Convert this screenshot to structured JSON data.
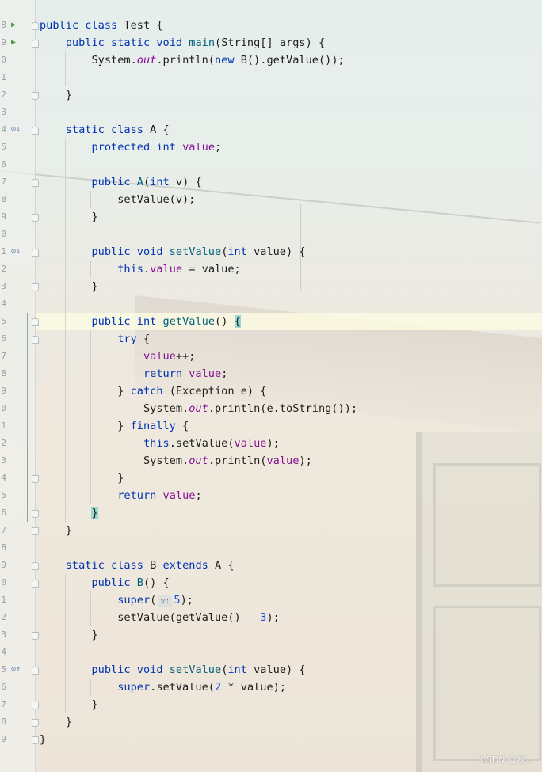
{
  "editor": {
    "lines": [
      {
        "n": "8",
        "marker": "run",
        "fold": "start",
        "tokens": [
          {
            "t": "public ",
            "c": "kw"
          },
          {
            "t": "class ",
            "c": "kw"
          },
          {
            "t": "Test {",
            "c": ""
          }
        ]
      },
      {
        "n": "9",
        "marker": "run",
        "fold": "start",
        "tokens": [
          {
            "t": "    "
          },
          {
            "t": "public ",
            "c": "kw"
          },
          {
            "t": "static ",
            "c": "kw"
          },
          {
            "t": "void ",
            "c": "kw"
          },
          {
            "t": "main",
            "c": "fn"
          },
          {
            "t": "(String[] args) {"
          }
        ]
      },
      {
        "n": "0",
        "fold": "",
        "tokens": [
          {
            "t": "        System."
          },
          {
            "t": "out",
            "c": "st"
          },
          {
            "t": ".println("
          },
          {
            "t": "new ",
            "c": "kw"
          },
          {
            "t": "B().getValue());"
          }
        ]
      },
      {
        "n": "1",
        "fold": "",
        "tokens": []
      },
      {
        "n": "2",
        "fold": "end",
        "tokens": [
          {
            "t": "    }"
          }
        ]
      },
      {
        "n": "3",
        "fold": "",
        "tokens": []
      },
      {
        "n": "4",
        "marker": "override",
        "fold": "start",
        "tokens": [
          {
            "t": "    "
          },
          {
            "t": "static ",
            "c": "kw"
          },
          {
            "t": "class ",
            "c": "kw"
          },
          {
            "t": "A {"
          }
        ]
      },
      {
        "n": "5",
        "fold": "",
        "tokens": [
          {
            "t": "        "
          },
          {
            "t": "protected ",
            "c": "kw"
          },
          {
            "t": "int ",
            "c": "kw"
          },
          {
            "t": "value",
            "c": "fld"
          },
          {
            "t": ";"
          }
        ]
      },
      {
        "n": "6",
        "fold": "",
        "tokens": []
      },
      {
        "n": "7",
        "fold": "start",
        "tokens": [
          {
            "t": "        "
          },
          {
            "t": "public ",
            "c": "kw"
          },
          {
            "t": "A",
            "c": "fn"
          },
          {
            "t": "("
          },
          {
            "t": "int ",
            "c": "kw"
          },
          {
            "t": "v) {"
          }
        ]
      },
      {
        "n": "8",
        "fold": "",
        "tokens": [
          {
            "t": "            setValue(v);"
          }
        ]
      },
      {
        "n": "9",
        "fold": "end",
        "tokens": [
          {
            "t": "        }"
          }
        ]
      },
      {
        "n": "0",
        "fold": "",
        "tokens": []
      },
      {
        "n": "1",
        "marker": "override",
        "fold": "start",
        "tokens": [
          {
            "t": "        "
          },
          {
            "t": "public ",
            "c": "kw"
          },
          {
            "t": "void ",
            "c": "kw"
          },
          {
            "t": "setValue",
            "c": "fn"
          },
          {
            "t": "("
          },
          {
            "t": "int ",
            "c": "kw"
          },
          {
            "t": "value) {"
          }
        ]
      },
      {
        "n": "2",
        "fold": "",
        "tokens": [
          {
            "t": "            "
          },
          {
            "t": "this",
            "c": "kw"
          },
          {
            "t": "."
          },
          {
            "t": "value",
            "c": "fld"
          },
          {
            "t": " = value;"
          }
        ]
      },
      {
        "n": "3",
        "fold": "end",
        "tokens": [
          {
            "t": "        }"
          }
        ]
      },
      {
        "n": "4",
        "fold": "",
        "tokens": []
      },
      {
        "n": "5",
        "fold": "start",
        "highlight": true,
        "tokens": [
          {
            "t": "        "
          },
          {
            "t": "public ",
            "c": "kw"
          },
          {
            "t": "int ",
            "c": "kw"
          },
          {
            "t": "getValue",
            "c": "fn"
          },
          {
            "t": "() "
          },
          {
            "t": "{",
            "c": "bracket"
          }
        ]
      },
      {
        "n": "6",
        "fold": "start",
        "tokens": [
          {
            "t": "            "
          },
          {
            "t": "try ",
            "c": "kw"
          },
          {
            "t": "{"
          }
        ]
      },
      {
        "n": "7",
        "fold": "",
        "tokens": [
          {
            "t": "                "
          },
          {
            "t": "value",
            "c": "fld"
          },
          {
            "t": "++;"
          }
        ]
      },
      {
        "n": "8",
        "fold": "",
        "tokens": [
          {
            "t": "                "
          },
          {
            "t": "return ",
            "c": "kw"
          },
          {
            "t": "value",
            "c": "fld"
          },
          {
            "t": ";"
          }
        ]
      },
      {
        "n": "9",
        "fold": "",
        "tokens": [
          {
            "t": "            } "
          },
          {
            "t": "catch ",
            "c": "kw"
          },
          {
            "t": "(Exception e) {"
          }
        ]
      },
      {
        "n": "0",
        "fold": "",
        "tokens": [
          {
            "t": "                System."
          },
          {
            "t": "out",
            "c": "st"
          },
          {
            "t": ".println(e.toString());"
          }
        ]
      },
      {
        "n": "1",
        "fold": "",
        "tokens": [
          {
            "t": "            } "
          },
          {
            "t": "finally ",
            "c": "kw"
          },
          {
            "t": "{"
          }
        ]
      },
      {
        "n": "2",
        "fold": "",
        "tokens": [
          {
            "t": "                "
          },
          {
            "t": "this",
            "c": "kw"
          },
          {
            "t": ".setValue("
          },
          {
            "t": "value",
            "c": "fld"
          },
          {
            "t": ");"
          }
        ]
      },
      {
        "n": "3",
        "fold": "",
        "tokens": [
          {
            "t": "                System."
          },
          {
            "t": "out",
            "c": "st"
          },
          {
            "t": ".println("
          },
          {
            "t": "value",
            "c": "fld"
          },
          {
            "t": ");"
          }
        ]
      },
      {
        "n": "4",
        "fold": "end",
        "tokens": [
          {
            "t": "            }"
          }
        ]
      },
      {
        "n": "5",
        "fold": "",
        "tokens": [
          {
            "t": "            "
          },
          {
            "t": "return ",
            "c": "kw"
          },
          {
            "t": "value",
            "c": "fld"
          },
          {
            "t": ";"
          }
        ]
      },
      {
        "n": "6",
        "fold": "end",
        "tokens": [
          {
            "t": "        "
          },
          {
            "t": "}",
            "c": "bracket"
          }
        ]
      },
      {
        "n": "7",
        "fold": "end",
        "tokens": [
          {
            "t": "    }"
          }
        ]
      },
      {
        "n": "8",
        "fold": "",
        "tokens": []
      },
      {
        "n": "9",
        "fold": "start",
        "tokens": [
          {
            "t": "    "
          },
          {
            "t": "static ",
            "c": "kw"
          },
          {
            "t": "class ",
            "c": "kw"
          },
          {
            "t": "B "
          },
          {
            "t": "extends ",
            "c": "kw"
          },
          {
            "t": "A {"
          }
        ]
      },
      {
        "n": "0",
        "fold": "start",
        "tokens": [
          {
            "t": "        "
          },
          {
            "t": "public ",
            "c": "kw"
          },
          {
            "t": "B",
            "c": "fn"
          },
          {
            "t": "() {"
          }
        ]
      },
      {
        "n": "1",
        "fold": "",
        "tokens": [
          {
            "t": "            "
          },
          {
            "t": "super",
            "c": "kw"
          },
          {
            "t": "("
          },
          {
            "t": "v:",
            "c": "hint"
          },
          {
            "t": "5",
            "c": "num"
          },
          {
            "t": ");"
          }
        ]
      },
      {
        "n": "2",
        "fold": "",
        "tokens": [
          {
            "t": "            setValue(getValue() - "
          },
          {
            "t": "3",
            "c": "num"
          },
          {
            "t": ");"
          }
        ]
      },
      {
        "n": "3",
        "fold": "end",
        "tokens": [
          {
            "t": "        }"
          }
        ]
      },
      {
        "n": "4",
        "fold": "",
        "tokens": []
      },
      {
        "n": "5",
        "marker": "override-up",
        "fold": "start",
        "tokens": [
          {
            "t": "        "
          },
          {
            "t": "public ",
            "c": "kw"
          },
          {
            "t": "void ",
            "c": "kw"
          },
          {
            "t": "setValue",
            "c": "fn"
          },
          {
            "t": "("
          },
          {
            "t": "int ",
            "c": "kw"
          },
          {
            "t": "value) {"
          }
        ]
      },
      {
        "n": "6",
        "fold": "",
        "tokens": [
          {
            "t": "            "
          },
          {
            "t": "super",
            "c": "kw"
          },
          {
            "t": ".setValue("
          },
          {
            "t": "2",
            "c": "num"
          },
          {
            "t": " * value);"
          }
        ]
      },
      {
        "n": "7",
        "fold": "end",
        "tokens": [
          {
            "t": "        }"
          }
        ]
      },
      {
        "n": "8",
        "fold": "end",
        "tokens": [
          {
            "t": "    }"
          }
        ]
      },
      {
        "n": "9",
        "fold": "end",
        "tokens": [
          {
            "t": "}"
          }
        ]
      }
    ],
    "markers": {
      "run": "▶",
      "override": "⊙↓",
      "override-up": "⊙↑"
    }
  },
  "watermark": "CSDN @牧.."
}
